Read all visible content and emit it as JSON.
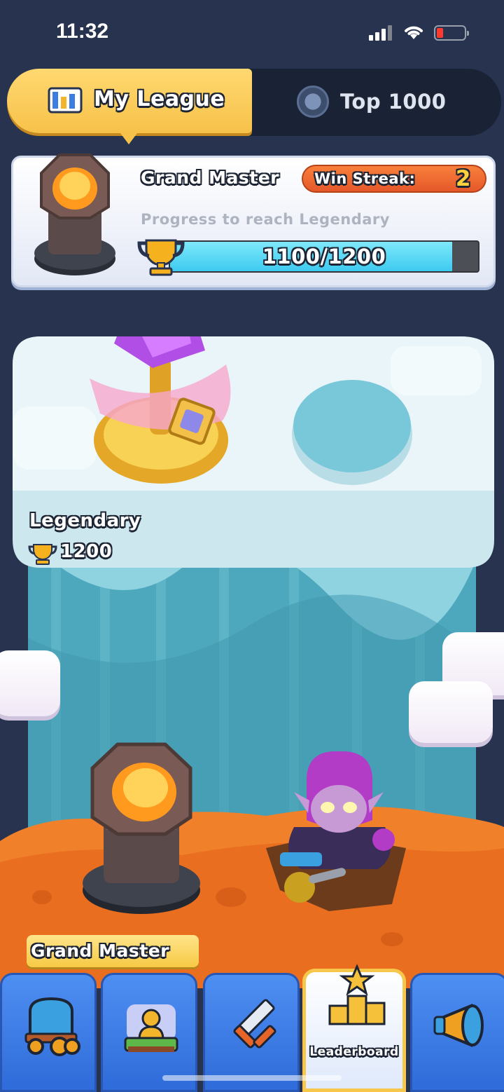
{
  "status_bar": {
    "time": "11:32"
  },
  "tabs": {
    "my_league": "My League",
    "top": "Top 1000",
    "active": "my_league"
  },
  "league_card": {
    "current_league": "Grand Master",
    "win_streak_label": "Win Streak:",
    "win_streak_value": "2",
    "progress_label": "Progress to reach Legendary",
    "progress_text": "1100/1200",
    "progress_fraction": 0.9167
  },
  "map": {
    "upper_league_name": "Legendary",
    "upper_league_trophies": "1200",
    "lower_league_name": "Grand Master"
  },
  "bottom_nav": {
    "items": [
      {
        "id": "shop",
        "icon": "wagon-icon",
        "label": ""
      },
      {
        "id": "clan",
        "icon": "castle-avatar-icon",
        "label": ""
      },
      {
        "id": "battle",
        "icon": "crossed-swords-icon",
        "label": ""
      },
      {
        "id": "leaderboard",
        "icon": "podium-star-icon",
        "label": "Leaderboard"
      },
      {
        "id": "events",
        "icon": "megaphone-icon",
        "label": ""
      }
    ],
    "active": "leaderboard"
  },
  "colors": {
    "background": "#27334f",
    "tab_active": "#f7c24a",
    "streak_badge": "#e5582a",
    "progress_fill": "#3dcaf0",
    "nav_blue": "#2f6bd9",
    "nav_active_border": "#f6c74b",
    "lava": "#f0812a",
    "ice": "#d8eef5"
  }
}
